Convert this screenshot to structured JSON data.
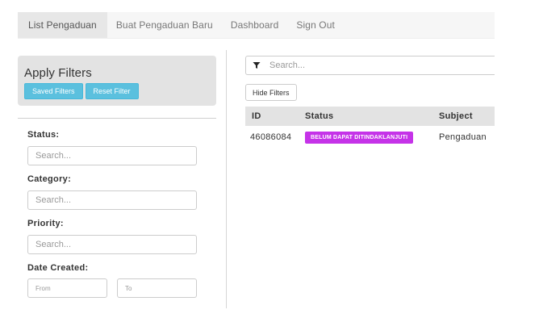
{
  "nav": {
    "items": [
      {
        "label": "List Pengaduan"
      },
      {
        "label": "Buat Pengaduan Baru"
      },
      {
        "label": "Dashboard"
      },
      {
        "label": "Sign Out"
      }
    ]
  },
  "sidebar": {
    "title": "Apply Filters",
    "saved_filters_label": "Saved Filters",
    "reset_filter_label": "Reset Filter",
    "status": {
      "label": "Status:",
      "placeholder": "Search..."
    },
    "category": {
      "label": "Category:",
      "placeholder": "Search..."
    },
    "priority": {
      "label": "Priority:",
      "placeholder": "Search..."
    },
    "date_created": {
      "label": "Date Created:",
      "from_placeholder": "From",
      "to_placeholder": "To"
    }
  },
  "main": {
    "search_placeholder": "Search...",
    "filter_icon": "filter-icon",
    "hide_filters_label": "Hide Filters",
    "table": {
      "columns": [
        "ID",
        "Status",
        "Subject"
      ],
      "rows": [
        {
          "id": "46086084",
          "status": "BELUM DAPAT DITINDAKLANJUTI",
          "subject": "Pengaduan"
        }
      ]
    }
  },
  "colors": {
    "accent_info": "#5bc0de",
    "status_badge": "#c533e8",
    "header_gray": "#e3e3e3"
  }
}
